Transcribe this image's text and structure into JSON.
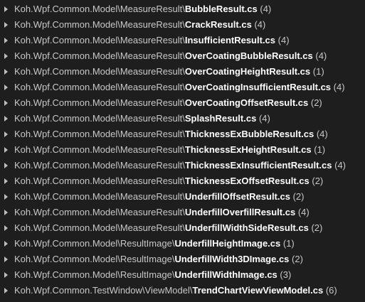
{
  "results": [
    {
      "path": "Koh.Wpf.Common.Model\\MeasureResult\\",
      "file": "BubbleResult.cs",
      "count": "(4)"
    },
    {
      "path": "Koh.Wpf.Common.Model\\MeasureResult\\",
      "file": "CrackResult.cs",
      "count": "(4)"
    },
    {
      "path": "Koh.Wpf.Common.Model\\MeasureResult\\",
      "file": "InsufficientResult.cs",
      "count": "(4)"
    },
    {
      "path": "Koh.Wpf.Common.Model\\MeasureResult\\",
      "file": "OverCoatingBubbleResult.cs",
      "count": "(4)"
    },
    {
      "path": "Koh.Wpf.Common.Model\\MeasureResult\\",
      "file": "OverCoatingHeightResult.cs",
      "count": "(1)"
    },
    {
      "path": "Koh.Wpf.Common.Model\\MeasureResult\\",
      "file": "OverCoatingInsufficientResult.cs",
      "count": "(4)"
    },
    {
      "path": "Koh.Wpf.Common.Model\\MeasureResult\\",
      "file": "OverCoatingOffsetResult.cs",
      "count": "(2)"
    },
    {
      "path": "Koh.Wpf.Common.Model\\MeasureResult\\",
      "file": "SplashResult.cs",
      "count": "(4)"
    },
    {
      "path": "Koh.Wpf.Common.Model\\MeasureResult\\",
      "file": "ThicknessExBubbleResult.cs",
      "count": "(4)"
    },
    {
      "path": "Koh.Wpf.Common.Model\\MeasureResult\\",
      "file": "ThicknessExHeightResult.cs",
      "count": "(1)"
    },
    {
      "path": "Koh.Wpf.Common.Model\\MeasureResult\\",
      "file": "ThicknessExInsufficientResult.cs",
      "count": "(4)"
    },
    {
      "path": "Koh.Wpf.Common.Model\\MeasureResult\\",
      "file": "ThicknessExOffsetResult.cs",
      "count": "(2)"
    },
    {
      "path": "Koh.Wpf.Common.Model\\MeasureResult\\",
      "file": "UnderfillOffsetResult.cs",
      "count": "(2)"
    },
    {
      "path": "Koh.Wpf.Common.Model\\MeasureResult\\",
      "file": "UnderfillOverfillResult.cs",
      "count": "(4)"
    },
    {
      "path": "Koh.Wpf.Common.Model\\MeasureResult\\",
      "file": "UnderfillWidthSideResult.cs",
      "count": "(2)"
    },
    {
      "path": "Koh.Wpf.Common.Model\\ResultImage\\",
      "file": "UnderfillHeightImage.cs",
      "count": "(1)"
    },
    {
      "path": "Koh.Wpf.Common.Model\\ResultImage\\",
      "file": "UnderfillWidth3DImage.cs",
      "count": "(2)"
    },
    {
      "path": "Koh.Wpf.Common.Model\\ResultImage\\",
      "file": "UnderfillWidthImage.cs",
      "count": "(3)"
    },
    {
      "path": "Koh.Wpf.Common.TestWindow\\ViewModel\\",
      "file": "TrendChartViewViewModel.cs",
      "count": "(6)"
    }
  ]
}
